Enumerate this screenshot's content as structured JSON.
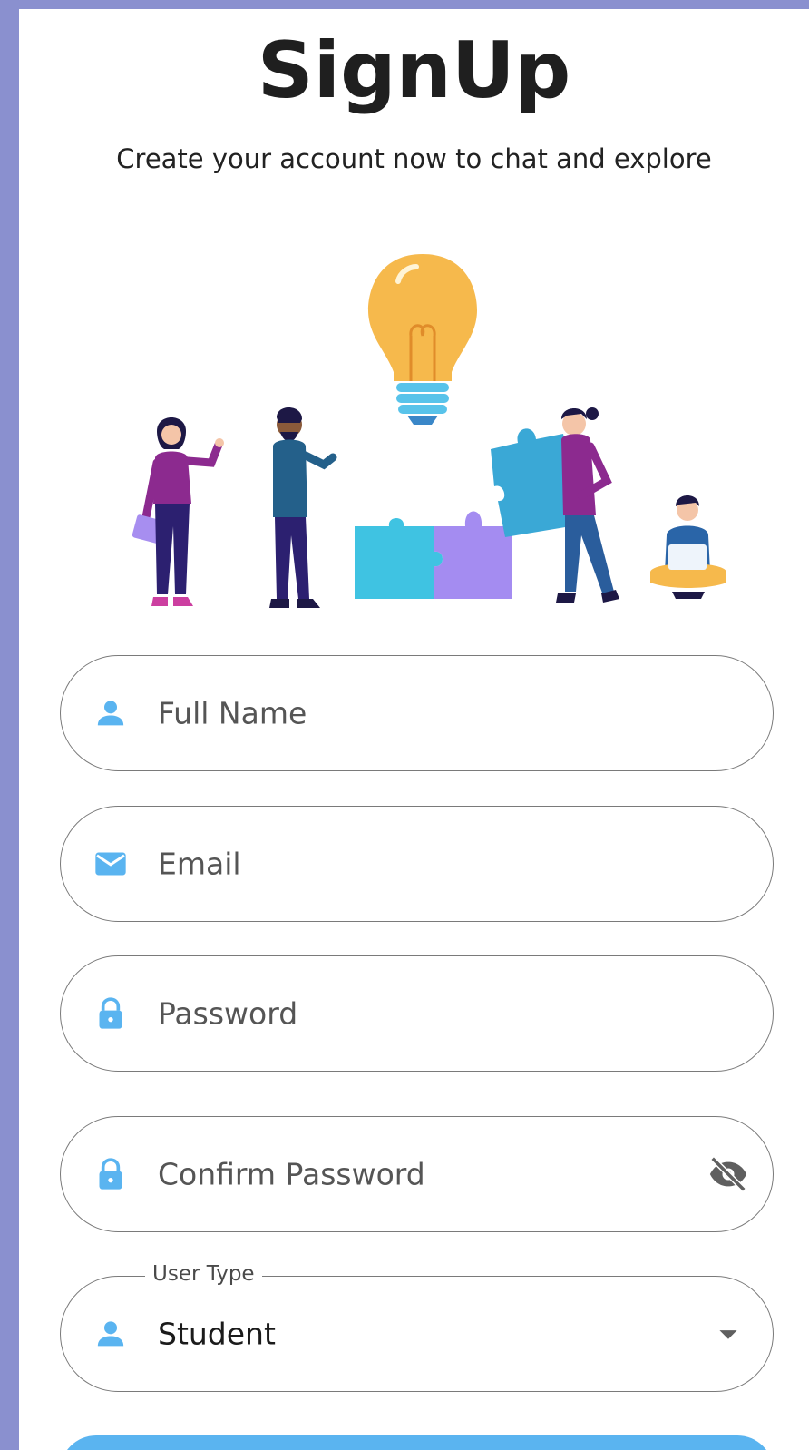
{
  "header": {
    "title": "SignUp",
    "subtitle": "Create your account now to chat and explore"
  },
  "form": {
    "full_name": {
      "placeholder": "Full Name",
      "icon": "person-icon"
    },
    "email": {
      "placeholder": "Email",
      "icon": "mail-icon"
    },
    "password": {
      "placeholder": "Password",
      "icon": "lock-icon"
    },
    "confirm_password": {
      "placeholder": "Confirm Password",
      "icon": "lock-icon",
      "trailing_icon": "visibility-off-icon"
    },
    "user_type": {
      "label": "User Type",
      "value": "Student",
      "icon": "person-icon",
      "trailing_icon": "dropdown-arrow-icon"
    }
  },
  "colors": {
    "accent": "#5ab4f0",
    "frame": "#8a90cf",
    "text": "#1f1f1f"
  }
}
